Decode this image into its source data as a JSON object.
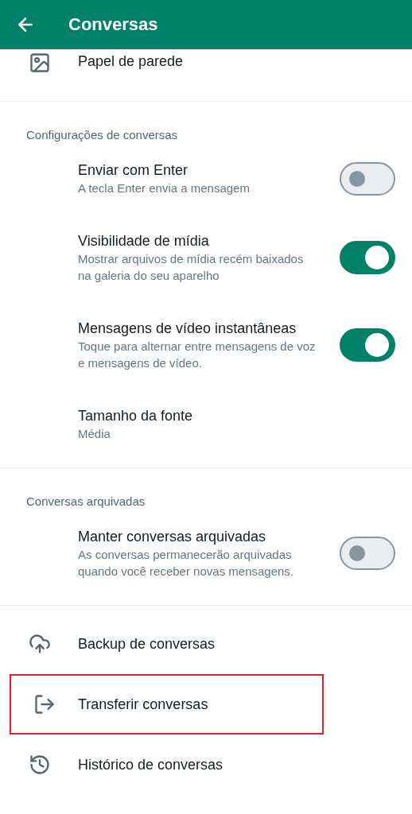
{
  "header": {
    "title": "Conversas"
  },
  "sections": [
    {
      "items": [
        {
          "kind": "link",
          "title": "Papel de parede"
        }
      ]
    },
    {
      "title": "Configurações de conversas",
      "items": [
        {
          "kind": "toggle",
          "title": "Enviar com Enter",
          "subtitle": "A tecla Enter envia a mensagem",
          "on": false
        },
        {
          "kind": "toggle",
          "title": "Visibilidade de mídia",
          "subtitle": "Mostrar arquivos de mídia recém baixados na galeria do seu aparelho",
          "on": true
        },
        {
          "kind": "toggle",
          "title": "Mensagens de vídeo instantâneas",
          "subtitle": "Toque para alternar entre mensagens de voz e mensagens de vídeo.",
          "on": true
        },
        {
          "kind": "text",
          "title": "Tamanho da fonte",
          "subtitle": "Média"
        }
      ]
    },
    {
      "title": "Conversas arquivadas",
      "items": [
        {
          "kind": "toggle",
          "title": "Manter conversas arquivadas",
          "subtitle": "As conversas permanecerão arquivadas quando você receber novas mensagens.",
          "on": false
        }
      ]
    },
    {
      "items": [
        {
          "kind": "link",
          "title": "Backup de conversas",
          "highlighted": false
        },
        {
          "kind": "link",
          "title": "Transferir conversas",
          "highlighted": true
        },
        {
          "kind": "link",
          "title": "Histórico de conversas",
          "highlighted": false
        }
      ]
    }
  ]
}
